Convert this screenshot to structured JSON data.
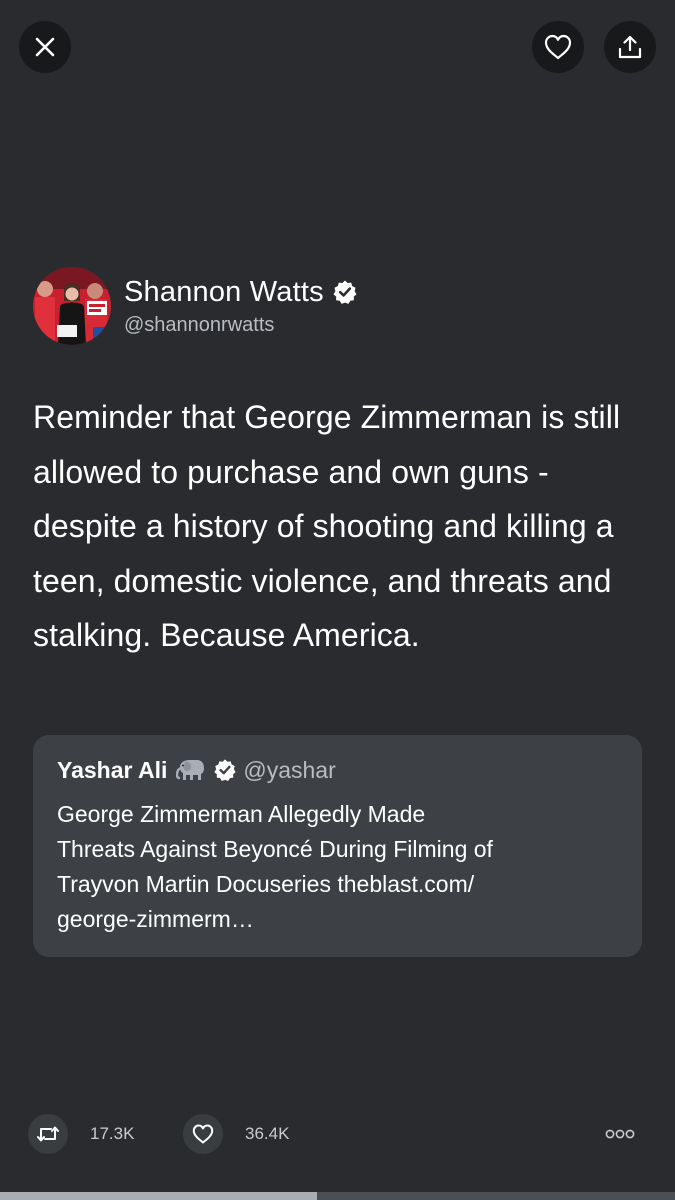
{
  "top_bar": {
    "close_icon": "close-icon",
    "like_icon": "heart-icon",
    "share_icon": "share-icon"
  },
  "tweet": {
    "author_name": "Shannon Watts",
    "author_handle": "@shannonrwatts",
    "verified": true,
    "text": "Reminder that George Zimmerman is still allowed to purchase and own guns - despite a history of shooting and killing a teen, domestic violence, and threats and stalking. Because America."
  },
  "quote": {
    "author_name": "Yashar Ali",
    "emoji_icon": "elephant-icon",
    "verified": true,
    "author_handle": "@yashar",
    "text": "George Zimmerman Allegedly Made\nThreats Against Beyoncé During Filming of\nTrayvon Martin Docuseries theblast.com/\ngeorge-zimmerm…"
  },
  "actions": {
    "retweet_count": "17.3K",
    "like_count": "36.4K",
    "more_icon": "more-options-icon"
  },
  "progress": {
    "fraction": 0.47
  },
  "colors": {
    "background": "#292b2e",
    "card": "#3d4145",
    "button": "#18191b",
    "secondary_text": "#b9bcc0"
  }
}
